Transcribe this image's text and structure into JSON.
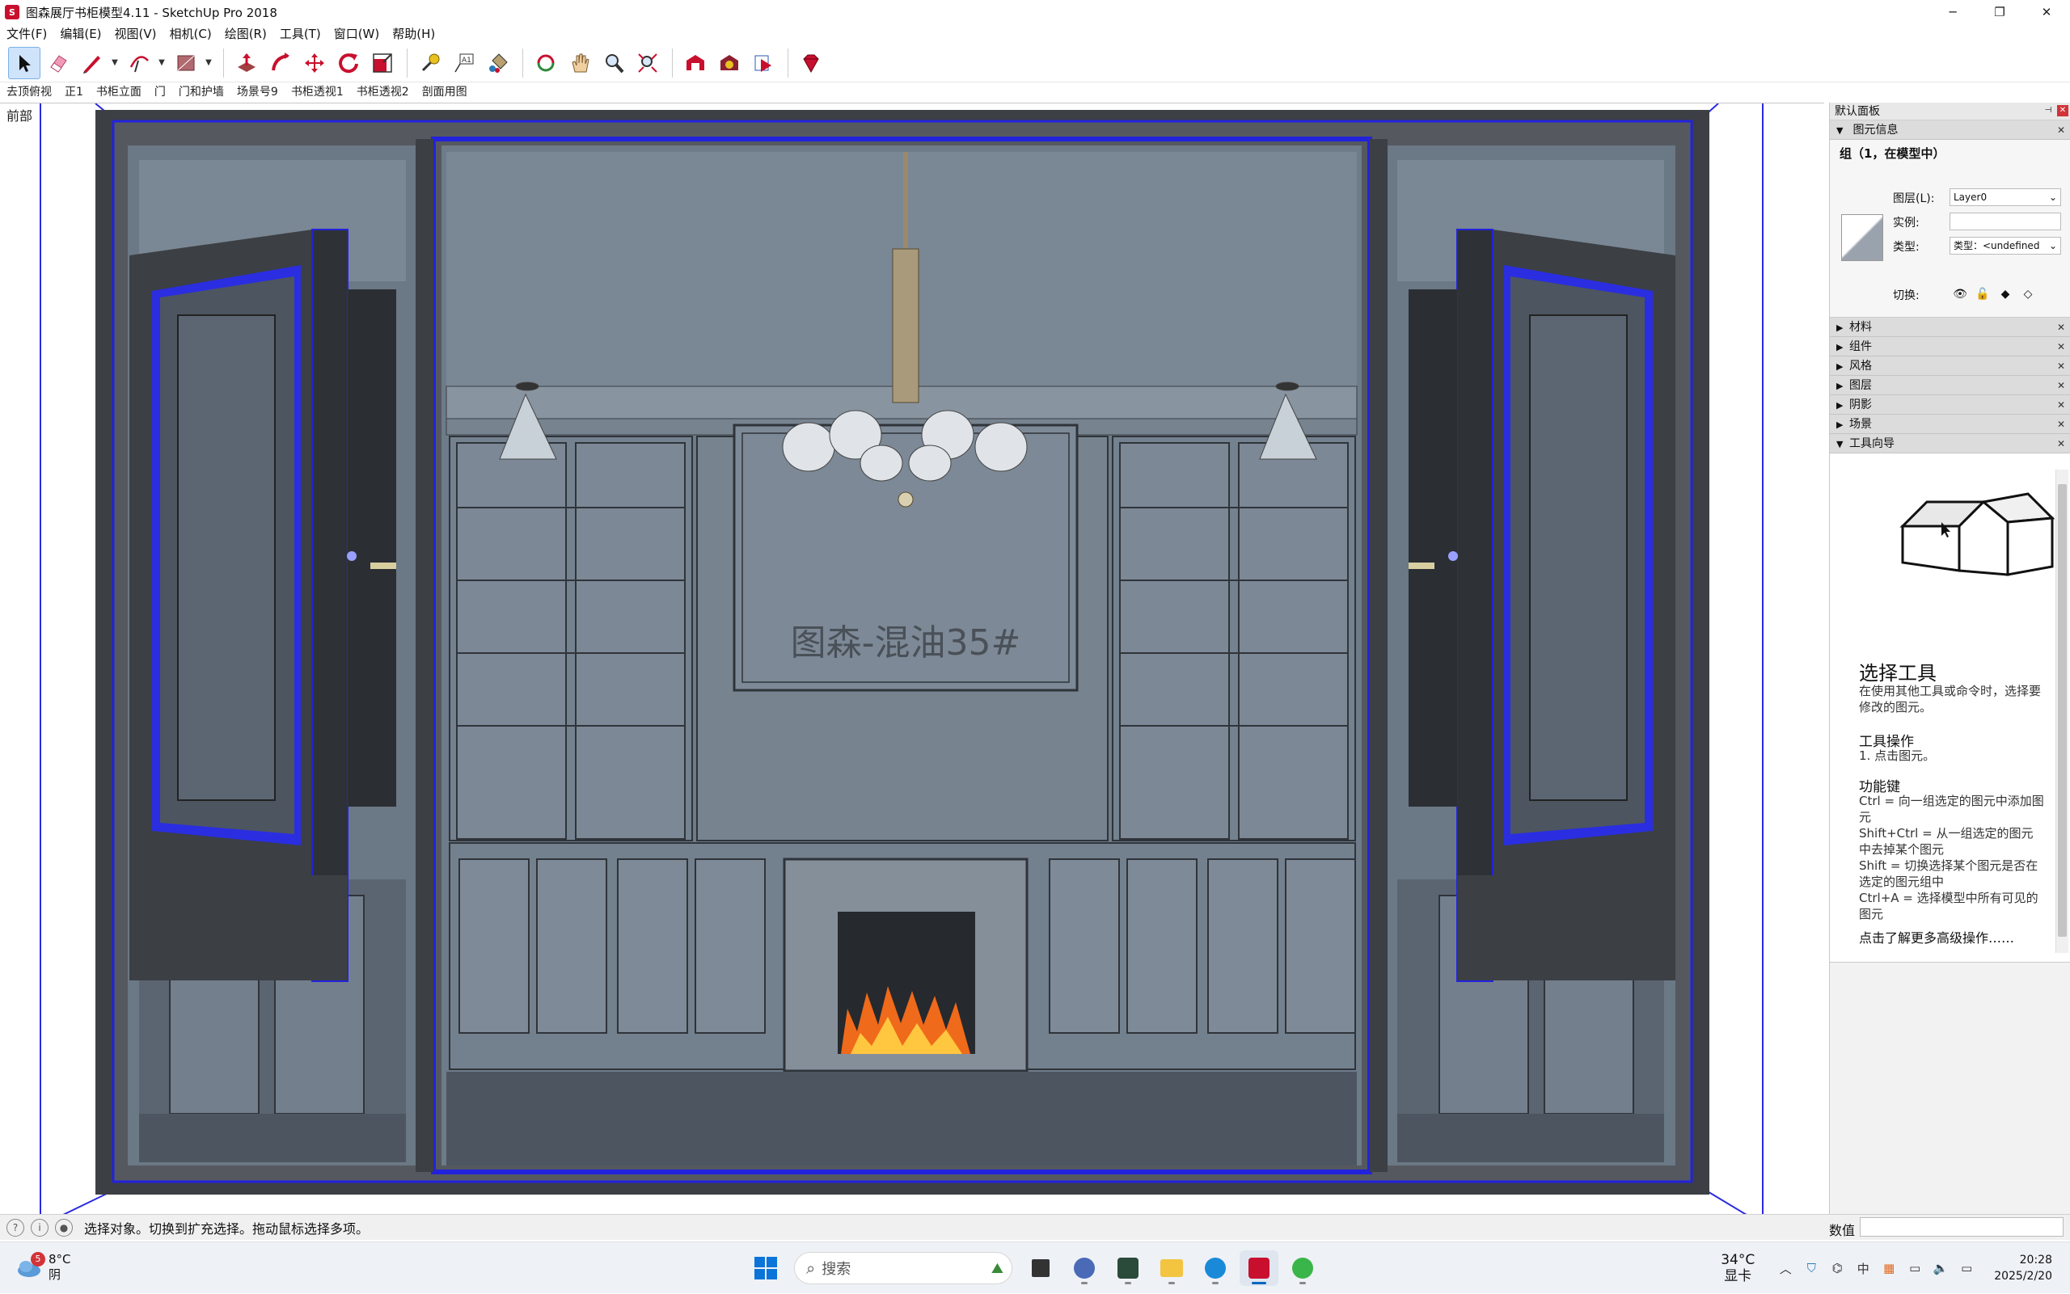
{
  "window": {
    "title": "图森展厅书柜模型4.11 - SketchUp Pro 2018",
    "app_icon_letter": "S",
    "minimize": "─",
    "restore": "❐",
    "close": "✕"
  },
  "menu": [
    "文件(F)",
    "编辑(E)",
    "视图(V)",
    "相机(C)",
    "绘图(R)",
    "工具(T)",
    "窗口(W)",
    "帮助(H)"
  ],
  "toolbar": {
    "tools": [
      "select-tool",
      "eraser-tool",
      "line-tool",
      "arc-tool",
      "shape-tool",
      "push-pull-tool",
      "offset-tool",
      "move-tool",
      "rotate-tool",
      "scale-tool",
      "tape-measure-tool",
      "text-tool",
      "paint-bucket-tool",
      "orbit-tool",
      "pan-tool",
      "zoom-tool",
      "zoom-extents-tool",
      "warehouse-tool",
      "extension-warehouse-tool",
      "layout-tool",
      "ruby-tool"
    ]
  },
  "scenes": [
    "去顶俯视",
    "正1",
    "书柜立面",
    "门",
    "门和护墙",
    "场景号9",
    "书柜透视1",
    "书柜透视2",
    "剖面用图"
  ],
  "viewport": {
    "view_label": "前部",
    "wall_text": "图森-混油35#"
  },
  "panel": {
    "title": "默认面板",
    "entity_info": {
      "tray_label": "图元信息",
      "selection": "组（1，在模型中）",
      "layer_label": "图层(L):",
      "layer_value": "Layer0",
      "instance_label": "实例:",
      "instance_value": "",
      "type_label": "类型:",
      "type_value": "类型：<undefined",
      "toggle_label": "切换:"
    },
    "trays": [
      "材料",
      "组件",
      "风格",
      "图层",
      "阴影",
      "场景"
    ],
    "instructor": {
      "tray_label": "工具向导",
      "tool_title": "选择工具",
      "tool_desc": "在使用其他工具或命令时，选择要修改的图元。",
      "ops_head": "工具操作",
      "ops_text": "1. 点击图元。",
      "keys_head": "功能键",
      "keys_text": [
        "Ctrl = 向一组选定的图元中添加图元",
        "Shift+Ctrl = 从一组选定的图元中去掉某个图元",
        "Shift = 切换选择某个图元是否在选定的图元组中",
        "Ctrl+A = 选择模型中所有可见的图元"
      ],
      "more_link": "点击了解更多高级操作……"
    }
  },
  "status": {
    "text": "选择对象。切换到扩充选择。拖动鼠标选择多项。",
    "measure_label": "数值",
    "measure_value": ""
  },
  "taskbar": {
    "weather_temp": "8°C",
    "weather_desc": "阴",
    "weather_badge": "5",
    "search_placeholder": "搜索",
    "tray_temp": "34°C",
    "tray_temp_label": "显卡",
    "ime": "中",
    "time": "20:28",
    "date": "2025/2/20"
  },
  "colors": {
    "selection_blue": "#1a1ae6",
    "frame_dark": "#3f4247",
    "room_gray": "#6f7d8c",
    "floor_gray": "#4c5560",
    "accent": "#0067c0"
  }
}
